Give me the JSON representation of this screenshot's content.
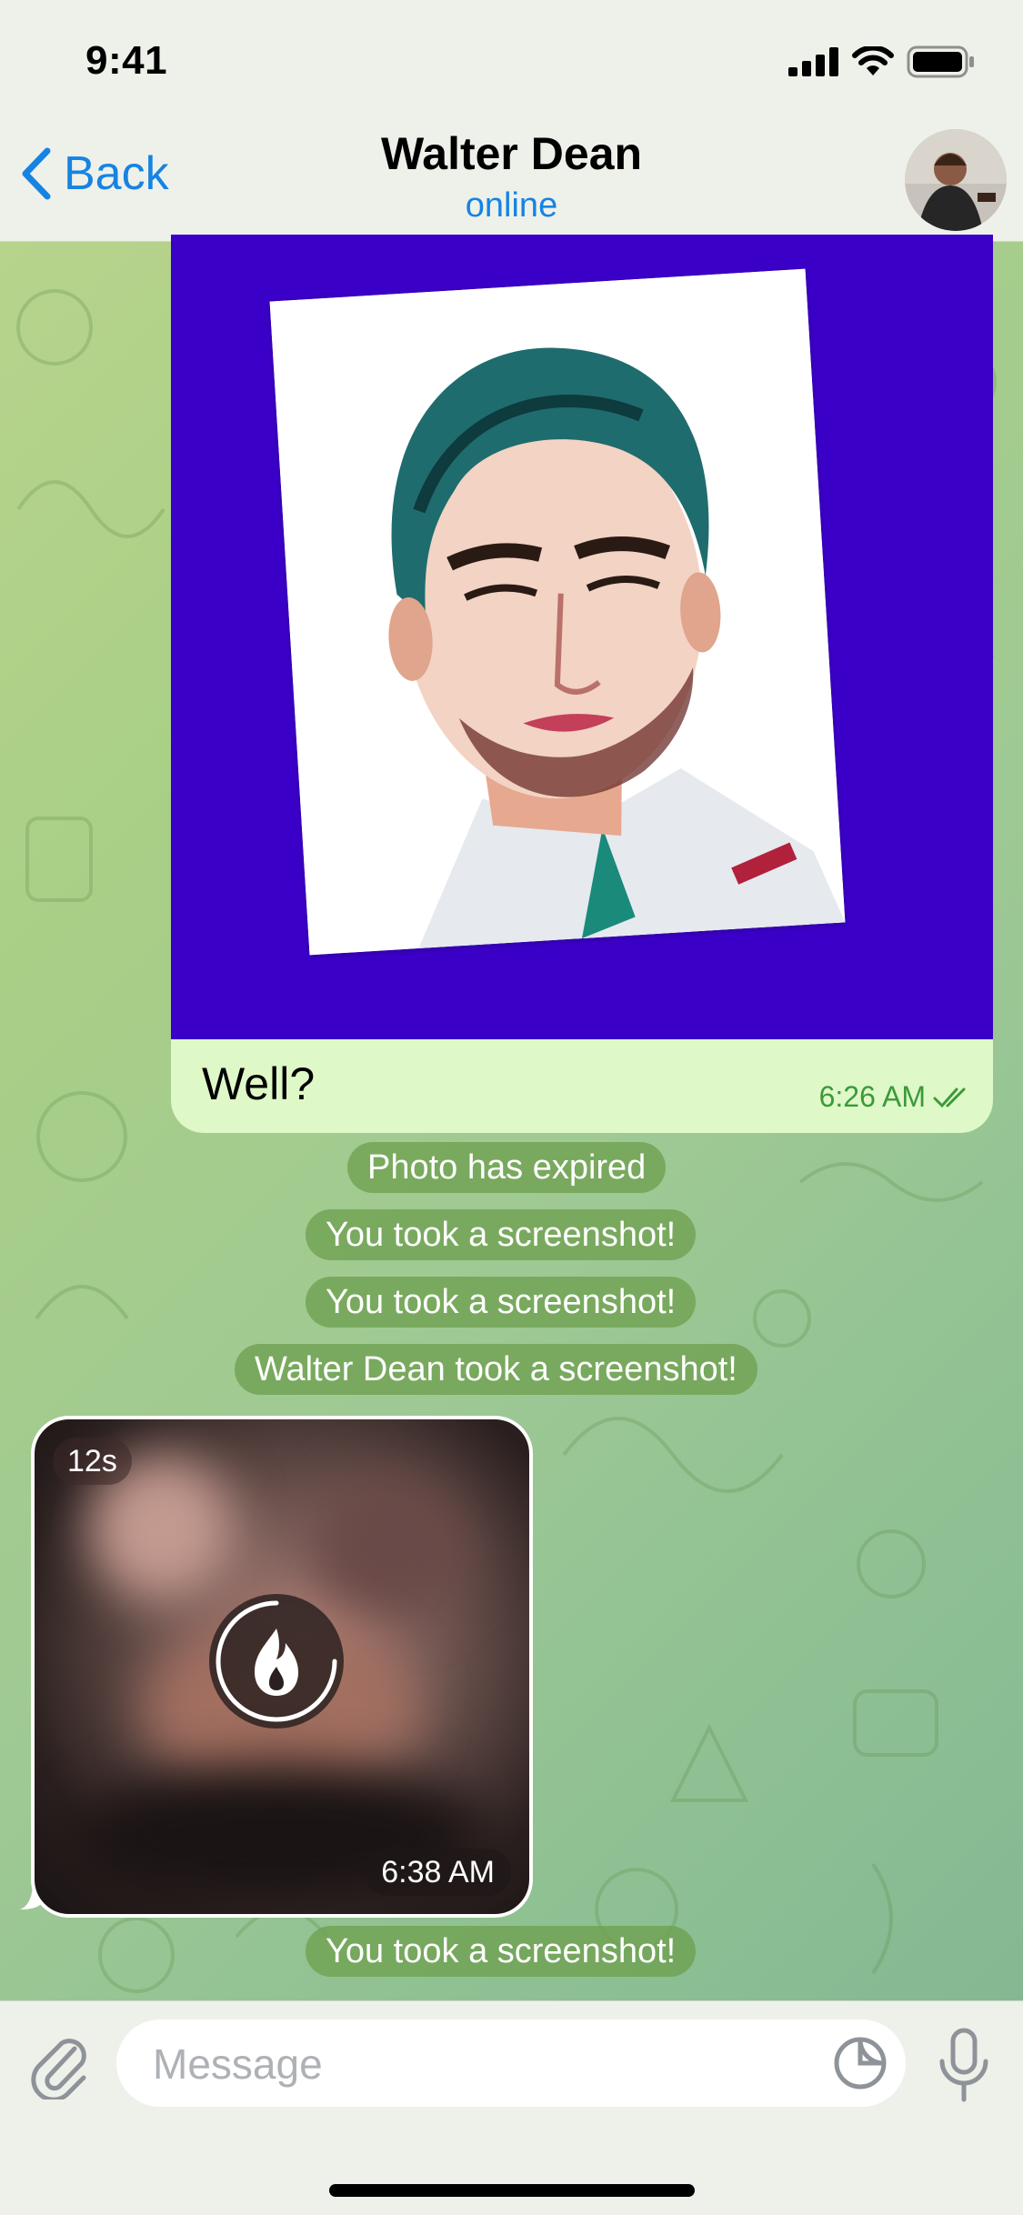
{
  "status_bar": {
    "time": "9:41"
  },
  "header": {
    "back_label": "Back",
    "title": "Walter Dean",
    "subtitle": "online"
  },
  "messages": {
    "outgoing_photo": {
      "caption": "Well?",
      "time": "6:26 AM",
      "status": "read"
    },
    "service": [
      "Photo has expired",
      "You took a screenshot!",
      "You took a screenshot!",
      "Walter Dean took a screenshot!"
    ],
    "incoming_media": {
      "timer": "12s",
      "time": "6:38 AM"
    },
    "service_bottom": "You took a screenshot!"
  },
  "composer": {
    "placeholder": "Message"
  },
  "colors": {
    "accent": "#1683e3",
    "outgoing_bubble": "#dff8c7",
    "photo_background": "#3b00c7",
    "service_pill": "#6ea050"
  },
  "icons": [
    "back-chevron-icon",
    "signal-icon",
    "wifi-icon",
    "battery-icon",
    "double-check-icon",
    "fire-icon",
    "attach-icon",
    "sticker-icon",
    "mic-icon"
  ]
}
